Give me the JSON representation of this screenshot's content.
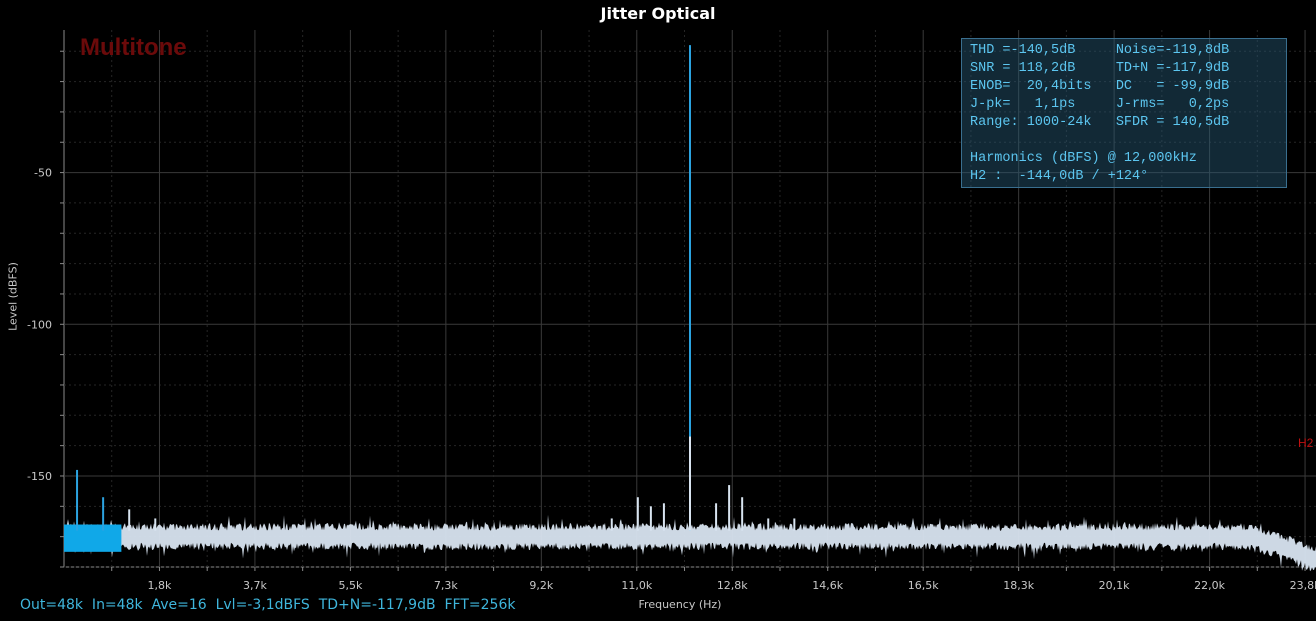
{
  "window": {
    "title": "Jitter Optical"
  },
  "watermark": "Multitone",
  "status_bar": "Out=48k  In=48k  Ave=16  Lvl=-3,1dBFS  TD+N=-117,9dB  FFT=256k",
  "stats_lines": [
    "THD =-140,5dB     Noise=-119,8dB",
    "SNR = 118,2dB     TD+N =-117,9dB",
    "ENOB=  20,4bits   DC   = -99,9dB",
    "J-pk=   1,1ps     J-rms=   0,2ps",
    "Range: 1000-24k   SFDR = 140,5dB",
    "",
    "Harmonics (dBFS) @ 12,000kHz",
    "H2 :  -144,0dB / +124°"
  ],
  "harmonic_marker": "H2",
  "colors": {
    "trace": "#d8e4f0",
    "trace_low": "#10a8e8",
    "carrier": "#2ba3e0",
    "grid": "#2c2c2c",
    "panel_bg": "#000000",
    "accent_red": "#c01010"
  },
  "chart_data": {
    "type": "line",
    "title": "Jitter Optical",
    "xlabel": "Frequency (Hz)",
    "ylabel": "Level (dBFS)",
    "xlim": [
      0,
      24000
    ],
    "ylim": [
      -180,
      -3
    ],
    "x_tick_labels": [
      "1,8k",
      "3,7k",
      "5,5k",
      "7,3k",
      "9,2k",
      "11,0k",
      "12,8k",
      "14,6k",
      "16,5k",
      "18,3k",
      "20,1k",
      "22,0k",
      "23,8k"
    ],
    "x_tick_values": [
      1830,
      3660,
      5490,
      7320,
      9150,
      10980,
      12810,
      14640,
      16470,
      18300,
      20130,
      21960,
      23790
    ],
    "y_tick_labels": [
      "-50",
      "-100",
      "-150"
    ],
    "y_tick_values": [
      -50,
      -100,
      -150
    ],
    "grid": true,
    "noise_floor_db": -170,
    "rolloff": {
      "start_hz": 22500,
      "end_db": -178
    },
    "series": [
      {
        "peaks": [
          {
            "x": 12000,
            "y": -8
          },
          {
            "x": 12000,
            "y": -137
          },
          {
            "x": 11500,
            "y": -159
          },
          {
            "x": 12500,
            "y": -159
          },
          {
            "x": 11000,
            "y": -157
          },
          {
            "x": 13000,
            "y": -157
          },
          {
            "x": 12750,
            "y": -153
          },
          {
            "x": 11250,
            "y": -160
          },
          {
            "x": 13500,
            "y": -164
          },
          {
            "x": 10500,
            "y": -164
          },
          {
            "x": 14000,
            "y": -164
          },
          {
            "x": 250,
            "y": -148
          },
          {
            "x": 750,
            "y": -157
          },
          {
            "x": 1250,
            "y": -161
          },
          {
            "x": 1750,
            "y": -164
          }
        ]
      }
    ]
  }
}
